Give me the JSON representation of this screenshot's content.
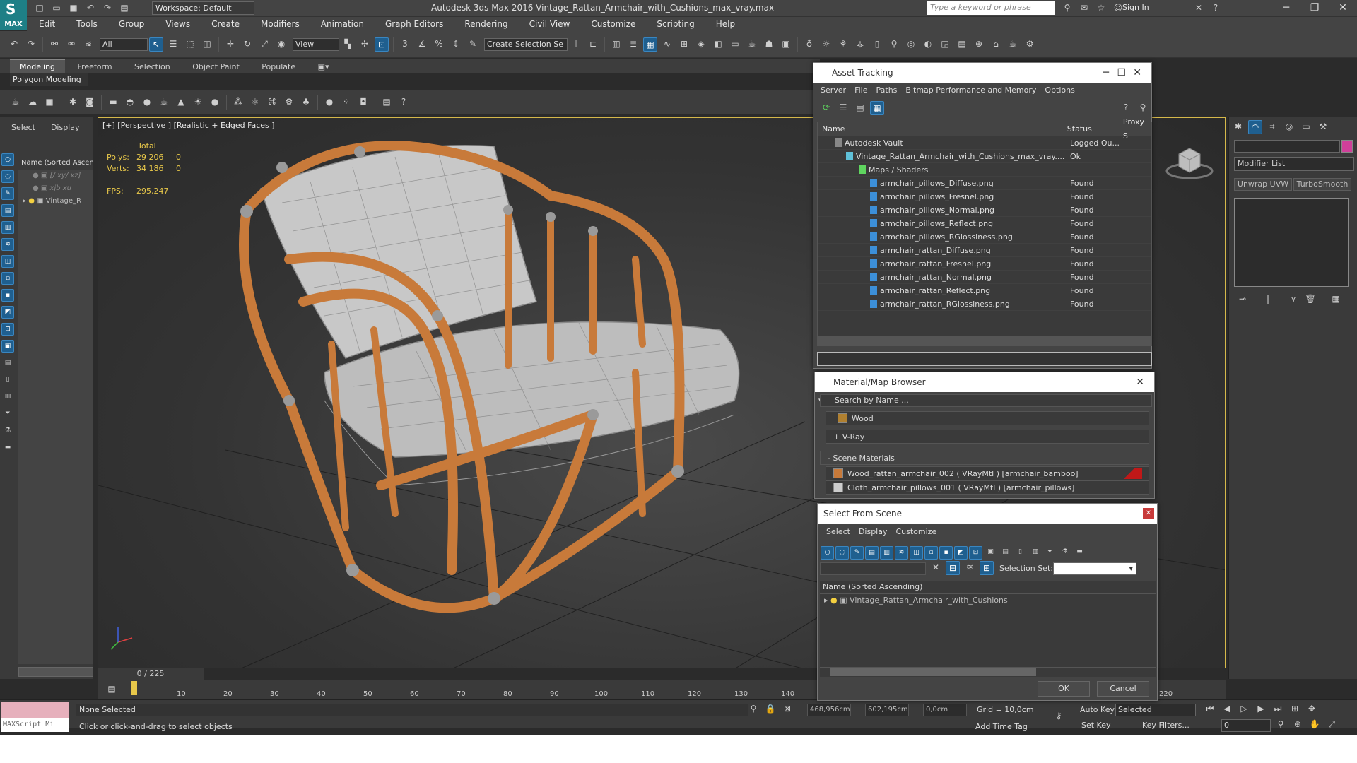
{
  "app": {
    "title": "Autodesk 3ds Max 2016     Vintage_Rattan_Armchair_with_Cushions_max_vray.max",
    "logo_label": "MAX",
    "workspace": "Workspace: Default",
    "search_placeholder": "Type a keyword or phrase",
    "sign_in": "Sign In"
  },
  "menu": [
    "Edit",
    "Tools",
    "Group",
    "Views",
    "Create",
    "Modifiers",
    "Animation",
    "Graph Editors",
    "Rendering",
    "Civil View",
    "Customize",
    "Scripting",
    "Help"
  ],
  "toolbar": {
    "filter": "All",
    "ref_coord": "View",
    "selection_set": "Create Selection Se"
  },
  "ribbon": {
    "tabs": [
      "Modeling",
      "Freeform",
      "Selection",
      "Object Paint",
      "Populate"
    ],
    "panel_label": "Polygon Modeling"
  },
  "scene_explorer": {
    "tabs": [
      "Select",
      "Display"
    ],
    "header": "Name (Sorted Ascen",
    "rows": [
      "[/ xy/ xz]",
      "xjb xu",
      "Vintage_R"
    ]
  },
  "viewport": {
    "label": "[+] [Perspective ] [Realistic + Edged Faces ]",
    "stats_header": "Total",
    "polys_label": "Polys:",
    "polys_value": "29 206",
    "polys_sel": "0",
    "verts_label": "Verts:",
    "verts_value": "34 186",
    "verts_sel": "0",
    "fps_label": "FPS:",
    "fps_value": "295,247",
    "frame_counter": "0 / 225"
  },
  "command_panel": {
    "modifier_list": "Modifier List",
    "btn1": "Unwrap UVW",
    "btn2": "TurboSmooth"
  },
  "timeline": {
    "ticks": [
      "10",
      "20",
      "30",
      "40",
      "50",
      "60",
      "70",
      "80",
      "90",
      "100",
      "110",
      "120",
      "130",
      "140",
      "220"
    ]
  },
  "status": {
    "selection": "None Selected",
    "hint": "Click or click-and-drag to select objects",
    "x": "468,956cm",
    "y": "602,195cm",
    "z": "0,0cm",
    "grid": "Grid = 10,0cm",
    "auto_key": "Auto Key",
    "set_key": "Set Key",
    "selected": "Selected",
    "key_filters": "Key Filters...",
    "frame": "0",
    "add_time_tag": "Add Time Tag",
    "maxscript": "MAXScript Mi"
  },
  "asset_tracking": {
    "title": "Asset Tracking",
    "menu": [
      "Server",
      "File",
      "Paths",
      "Bitmap Performance and Memory",
      "Options"
    ],
    "columns": [
      "Name",
      "Status",
      "Proxy S"
    ],
    "rows": [
      {
        "name": "Autodesk Vault",
        "status": "Logged Ou..."
      },
      {
        "name": "Vintage_Rattan_Armchair_with_Cushions_max_vray....",
        "status": "Ok"
      },
      {
        "name": "Maps / Shaders",
        "status": ""
      },
      {
        "name": "armchair_pillows_Diffuse.png",
        "status": "Found"
      },
      {
        "name": "armchair_pillows_Fresnel.png",
        "status": "Found"
      },
      {
        "name": "armchair_pillows_Normal.png",
        "status": "Found"
      },
      {
        "name": "armchair_pillows_Reflect.png",
        "status": "Found"
      },
      {
        "name": "armchair_pillows_RGlossiness.png",
        "status": "Found"
      },
      {
        "name": "armchair_rattan_Diffuse.png",
        "status": "Found"
      },
      {
        "name": "armchair_rattan_Fresnel.png",
        "status": "Found"
      },
      {
        "name": "armchair_rattan_Normal.png",
        "status": "Found"
      },
      {
        "name": "armchair_rattan_Reflect.png",
        "status": "Found"
      },
      {
        "name": "armchair_rattan_RGlossiness.png",
        "status": "Found"
      }
    ]
  },
  "material_browser": {
    "title": "Material/Map Browser",
    "search_placeholder": "Search by Name ...",
    "group_wood": "Wood",
    "group_vray": "+ V-Ray",
    "group_scene": "- Scene Materials",
    "materials": [
      "Wood_rattan_armchair_002  ( VRayMtl )  [armchair_bamboo]",
      "Cloth_armchair_pillows_001  ( VRayMtl )  [armchair_pillows]"
    ]
  },
  "select_from_scene": {
    "title": "Select From Scene",
    "menu": [
      "Select",
      "Display",
      "Customize"
    ],
    "selection_set_label": "Selection Set:",
    "list_header": "Name (Sorted Ascending)",
    "item": "Vintage_Rattan_Armchair_with_Cushions",
    "ok": "OK",
    "cancel": "Cancel"
  },
  "colors": {
    "accent": "#1e7f86",
    "viewport_border": "#d5b84a",
    "stats": "#e8c84a",
    "rattan": "#c87a3a"
  }
}
